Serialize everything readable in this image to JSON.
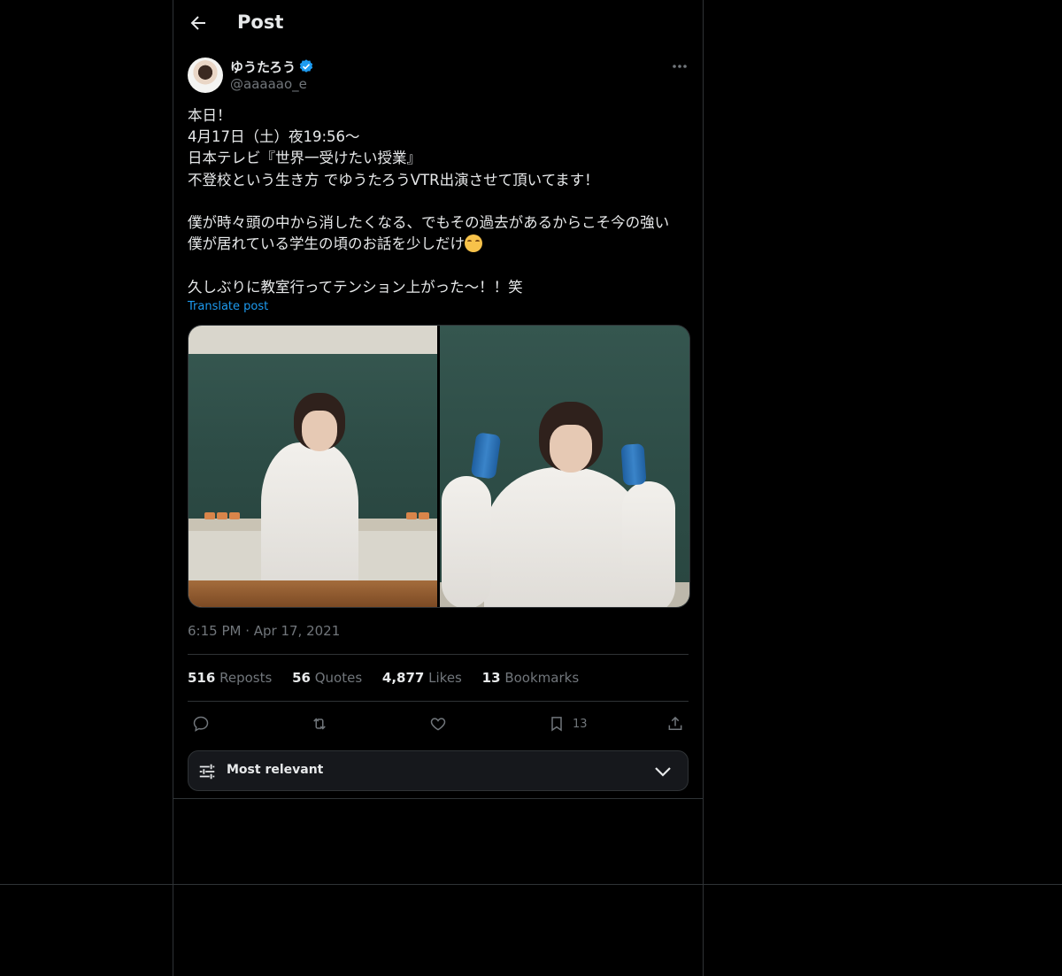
{
  "header": {
    "title": "Post"
  },
  "author": {
    "name": "ゆうたろう",
    "handle": "@aaaaao_e",
    "verified": true
  },
  "post": {
    "lines": [
      "本日！",
      "4月17日（土）夜19:56〜",
      "日本テレビ『世界一受けたい授業』",
      "不登校という生き方 でゆうたろうVTR出演させて頂いてます！",
      "",
      "僕が時々頭の中から消したくなる、でもその過去があるからこそ今の強い",
      "僕が居れている学生の頃のお話を少しだけ",
      "",
      "久しぶりに教室行ってテンション上がった〜！！笑"
    ],
    "emoji": "smiling-face-icon",
    "translate_label": "Translate post",
    "timestamp": "6:15 PM · Apr 17, 2021"
  },
  "stats": [
    {
      "count": "516",
      "label": "Reposts"
    },
    {
      "count": "56",
      "label": "Quotes"
    },
    {
      "count": "4,877",
      "label": "Likes"
    },
    {
      "count": "13",
      "label": "Bookmarks"
    }
  ],
  "actions": {
    "bookmark_count": "13"
  },
  "sort": {
    "label": "Most relevant"
  },
  "colors": {
    "accent": "#1d9bf0",
    "background": "#000000",
    "text": "#e7e9ea",
    "muted": "#71767b",
    "border": "#2f3336"
  }
}
